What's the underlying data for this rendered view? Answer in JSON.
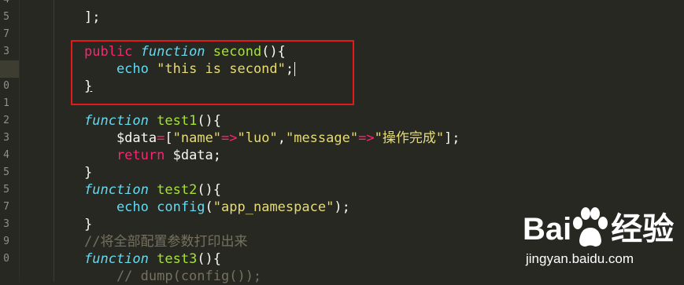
{
  "line_numbers": [
    "4",
    "5",
    "7",
    "3",
    "9",
    "0",
    "1",
    "2",
    "3",
    "4",
    "5",
    "5",
    "7",
    "3",
    "9",
    "0"
  ],
  "lines": [
    {
      "tokens": [
        {
          "t": "];",
          "c": "plain"
        }
      ]
    },
    {
      "tokens": []
    },
    {
      "tokens": [
        {
          "t": "public ",
          "c": "kw-pink"
        },
        {
          "t": "function ",
          "c": "kw-fn"
        },
        {
          "t": "second",
          "c": "fname"
        },
        {
          "t": "(){",
          "c": "plain"
        }
      ]
    },
    {
      "tokens": [
        {
          "t": "    echo ",
          "c": "kw-blue"
        },
        {
          "t": "\"this is second\"",
          "c": "str"
        },
        {
          "t": ";",
          "c": "plain"
        }
      ]
    },
    {
      "tokens": [
        {
          "t": "}",
          "c": "plain brace-u"
        }
      ]
    },
    {
      "tokens": []
    },
    {
      "tokens": [
        {
          "t": "function ",
          "c": "kw-fn"
        },
        {
          "t": "test1",
          "c": "fname"
        },
        {
          "t": "(){",
          "c": "plain"
        }
      ]
    },
    {
      "tokens": [
        {
          "t": "    $data",
          "c": "plain"
        },
        {
          "t": "=",
          "c": "kw-pink"
        },
        {
          "t": "[",
          "c": "plain"
        },
        {
          "t": "\"name\"",
          "c": "str"
        },
        {
          "t": "=>",
          "c": "kw-pink"
        },
        {
          "t": "\"luo\"",
          "c": "str"
        },
        {
          "t": ",",
          "c": "plain"
        },
        {
          "t": "\"message\"",
          "c": "str"
        },
        {
          "t": "=>",
          "c": "kw-pink"
        },
        {
          "t": "\"操作完成\"",
          "c": "str"
        },
        {
          "t": "];",
          "c": "plain"
        }
      ]
    },
    {
      "tokens": [
        {
          "t": "    return ",
          "c": "kw-pink"
        },
        {
          "t": "$data;",
          "c": "plain"
        }
      ]
    },
    {
      "tokens": [
        {
          "t": "}",
          "c": "plain"
        }
      ]
    },
    {
      "tokens": [
        {
          "t": "function ",
          "c": "kw-fn"
        },
        {
          "t": "test2",
          "c": "fname"
        },
        {
          "t": "(){",
          "c": "plain"
        }
      ]
    },
    {
      "tokens": [
        {
          "t": "    echo ",
          "c": "kw-blue"
        },
        {
          "t": "config",
          "c": "kw-blue"
        },
        {
          "t": "(",
          "c": "plain"
        },
        {
          "t": "\"app_namespace\"",
          "c": "str"
        },
        {
          "t": ");",
          "c": "plain"
        }
      ]
    },
    {
      "tokens": [
        {
          "t": "}",
          "c": "plain"
        }
      ]
    },
    {
      "tokens": [
        {
          "t": "//将全部配置参数打印出来",
          "c": "cmt"
        }
      ]
    },
    {
      "tokens": [
        {
          "t": "function ",
          "c": "kw-fn"
        },
        {
          "t": "test3",
          "c": "fname"
        },
        {
          "t": "(){",
          "c": "plain"
        }
      ]
    },
    {
      "tokens": [
        {
          "t": "    // dump(config());",
          "c": "cmt"
        }
      ]
    }
  ],
  "watermark": {
    "logo_prefix": "Bai",
    "logo_suffix": "经验",
    "url": "jingyan.baidu.com"
  },
  "colors": {
    "background": "#272822",
    "highlight_box": "#e21a1a"
  }
}
